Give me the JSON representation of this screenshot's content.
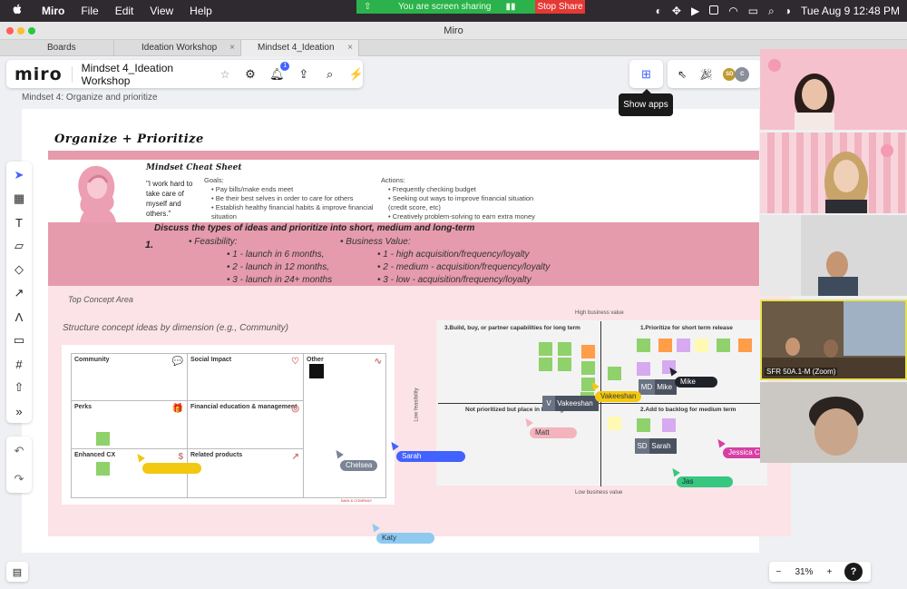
{
  "menubar": {
    "app": "Miro",
    "items": [
      "File",
      "Edit",
      "View",
      "Help"
    ],
    "sharing_text": "You are screen sharing",
    "stop_share": "Stop Share",
    "clock": "Tue Aug 9  12:48 PM"
  },
  "window": {
    "title": "Miro"
  },
  "tabs": [
    {
      "label": "Boards"
    },
    {
      "label": "Ideation Workshop"
    },
    {
      "label": "Mindset 4_Ideation Works..."
    }
  ],
  "toolbar": {
    "logo": "miro",
    "board_title": "Mindset 4_Ideation Workshop",
    "notif_count": "1",
    "tooltip": "Show apps",
    "avatars": [
      "SD",
      "C"
    ]
  },
  "frame_label": "Mindset 4: Organize and prioritize",
  "workshop": {
    "title": "Organize + Prioritize",
    "cheat_title": "Mindset Cheat Sheet",
    "quote": "\"I work hard to take care of myself and others.\"",
    "goals_label": "Goals:",
    "goals": [
      "Pay bills/make ends meet",
      "Be their best selves in order to care for others",
      "Establish healthy financial habits & improve financial situation"
    ],
    "actions_label": "Actions:",
    "actions": [
      "Frequently checking budget",
      "Seeking out ways to improve financial situation (credit score, etc)",
      "Creatively problem-solving to earn extra money"
    ],
    "discuss": "Discuss the types of ideas and prioritize into short, medium and long-term",
    "step_num": "1.",
    "feasibility_label": "Feasibility:",
    "feasibility": [
      "1 - launch in 6 months,",
      "2 - launch in 12 months,",
      "3 - launch in 24+ months"
    ],
    "business_label": "Business Value:",
    "business": [
      "1 - high acquisition/frequency/loyalty",
      "2 - medium - acquisition/frequency/loyalty",
      "3 - low - acquisition/frequency/loyalty"
    ],
    "top_concept": "Top Concept Area",
    "structure": "Structure concept ideas by dimension (e.g., Community)"
  },
  "grid": {
    "cells": [
      "Community",
      "Social Impact",
      "Other",
      "Perks",
      "Financial education & management",
      "",
      "Enhanced CX",
      "Related products",
      ""
    ],
    "brand": "BAIN & COMPANY"
  },
  "quadrant": {
    "high": "High business value",
    "low": "Low business value",
    "low_feasibility": "Low feasibility",
    "q1": "3.Build, buy, or partner capabilities for long term",
    "q2": "1.Prioritize for short term release",
    "q3": "Not prioritized but place in backlog",
    "q4": "2.Add to backlog for medium term"
  },
  "collaborators": {
    "sarah": "Sarah",
    "chelsea": "Chelsea",
    "katy": "Katy",
    "matt": "Matt",
    "jas": "Jas",
    "jessica": "Jessica Ca",
    "vakeeshan": "Vakeeshan",
    "mike": "Mike",
    "v_card": "Vakeeshan",
    "v_initial": "V",
    "md_initial": "MD",
    "md_card": "Mike",
    "sd_initial": "SD",
    "sd_card": "Sarah"
  },
  "video": {
    "room_label": "SFR 50A.1-M (Zoom)"
  },
  "zoom": {
    "level": "31%",
    "minus": "−",
    "plus": "+",
    "help": "?"
  },
  "colors": {
    "accent": "#4262ff",
    "pink": "#e59bab",
    "light_pink": "#fbe3e8",
    "share_green": "#2bb24c",
    "stop_red": "#e53935"
  }
}
